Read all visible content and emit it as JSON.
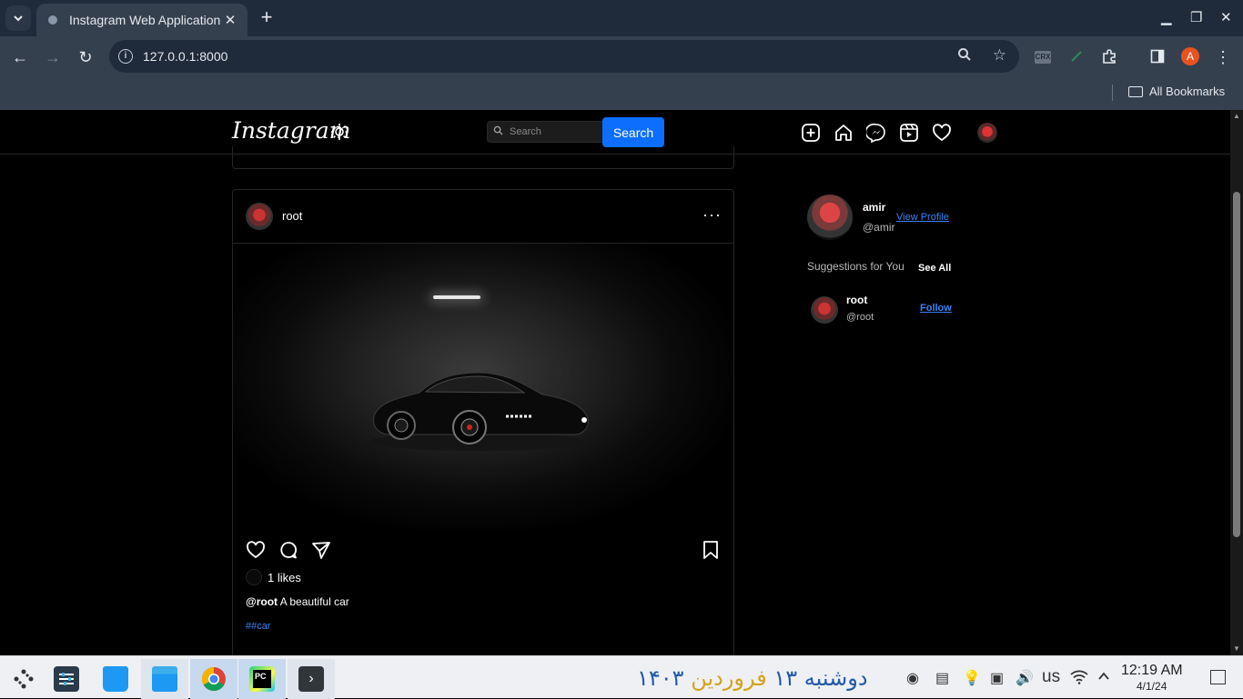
{
  "browser": {
    "tab_title": "Instagram Web Application",
    "url": "127.0.0.1:8000",
    "bookmarks_label": "All Bookmarks",
    "profile_initial": "A",
    "ext_crx": "CRX"
  },
  "header": {
    "logo": "Instagram",
    "search_placeholder": "Search",
    "search_button": "Search"
  },
  "post": {
    "username": "root",
    "more": "···",
    "likes": "1 likes",
    "caption_user": "@root",
    "caption_text": "A beautiful car",
    "hashtag": "##car"
  },
  "sidebar": {
    "name": "amir",
    "handle": "@amir",
    "view_profile": "View Profile",
    "suggestions_title": "Suggestions for You",
    "see_all": "See All",
    "suggestions": [
      {
        "name": "root",
        "handle": "@root",
        "action": "Follow"
      }
    ]
  },
  "taskbar": {
    "date_fa_day": "دوشنبه ۱۳",
    "date_fa_month": "فروردین",
    "date_fa_year": "۱۴۰۳",
    "keyboard_layout": "us",
    "time": "12:19 AM",
    "date": "4/1/24"
  }
}
